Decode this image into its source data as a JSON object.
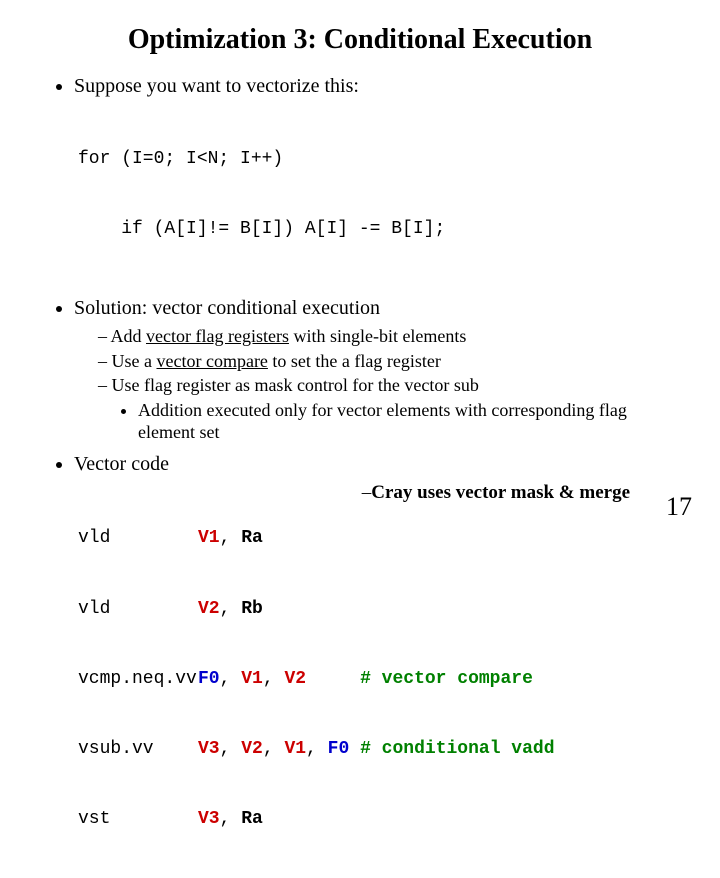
{
  "title": "Optimization 3: Conditional Execution",
  "b1": {
    "lead": "Suppose you want to vectorize this:",
    "code1": "for (I=0; I<N; I++)",
    "code2": "    if (A[I]!= B[I]) A[I] -= B[I];"
  },
  "b2": {
    "lead": "Solution: vector conditional execution",
    "s1a": "Add ",
    "s1b": "vector flag registers",
    "s1c": " with single-bit elements",
    "s2a": "Use a ",
    "s2b": "vector compare",
    "s2c": " to set the a flag register",
    "s3": "Use flag register as mask control for the vector sub",
    "s3sub": "Addition executed only for vector elements with corresponding flag element set"
  },
  "b3": {
    "lead": "Vector code",
    "r1": {
      "op": "vld",
      "a1": "V1",
      "c1": ", ",
      "a2": "Ra"
    },
    "r2": {
      "op": "vld",
      "a1": "V2",
      "c1": ", ",
      "a2": "Rb"
    },
    "r3": {
      "op": "vcmp.neq.vv",
      "a1": "F0",
      "c1": ", ",
      "a2": "V1",
      "c2": ", ",
      "a3": "V2",
      "pad": "     ",
      "cm": "# vector compare"
    },
    "r4": {
      "op": "vsub.vv",
      "a1": "V3",
      "c1": ", ",
      "a2": "V2",
      "c2": ", ",
      "a3": "V1",
      "c3": ", ",
      "a4": "F0",
      "pad": " ",
      "cm": "# conditional vadd"
    },
    "r5": {
      "op": "vst",
      "a1": "V3",
      "c1": ", ",
      "a2": "Ra"
    }
  },
  "footer": {
    "dash": "–",
    "text": "Cray uses vector mask & merge"
  },
  "page": "17"
}
